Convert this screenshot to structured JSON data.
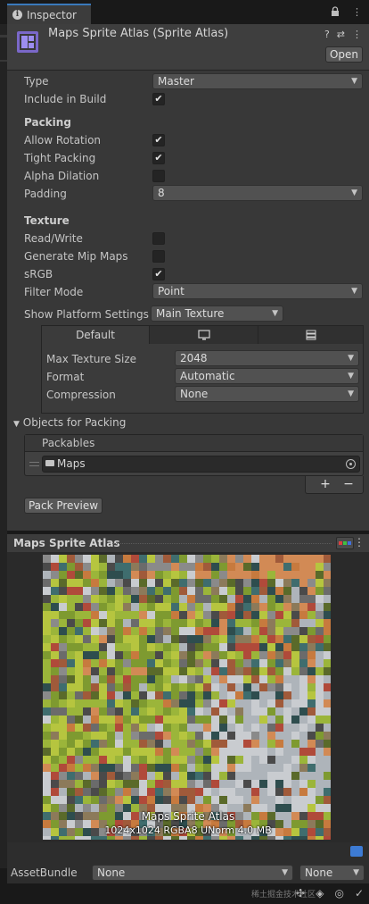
{
  "window": {
    "tab_label": "Inspector",
    "tab_icons": [
      "lock-icon",
      "kebab-icon"
    ]
  },
  "header": {
    "title": "Maps Sprite Atlas (Sprite Atlas)",
    "help_glyph": "?",
    "settings_glyph": "⇄",
    "more_glyph": "⋮",
    "open_label": "Open"
  },
  "fields": {
    "type_label": "Type",
    "type_value": "Master",
    "include_build_label": "Include in Build",
    "include_build_checked": true,
    "packing_header": "Packing",
    "allow_rotation_label": "Allow Rotation",
    "allow_rotation_checked": true,
    "tight_packing_label": "Tight Packing",
    "tight_packing_checked": true,
    "alpha_dilation_label": "Alpha Dilation",
    "alpha_dilation_checked": false,
    "padding_label": "Padding",
    "padding_value": "8",
    "texture_header": "Texture",
    "read_write_label": "Read/Write",
    "read_write_checked": false,
    "mip_maps_label": "Generate Mip Maps",
    "mip_maps_checked": false,
    "srgb_label": "sRGB",
    "srgb_checked": true,
    "filter_mode_label": "Filter Mode",
    "filter_mode_value": "Point",
    "platform_settings_label": "Show Platform Settings F",
    "platform_settings_value": "Main Texture"
  },
  "platform": {
    "tabs": [
      "Default",
      "monitor-icon",
      "server-icon"
    ],
    "max_size_label": "Max Texture Size",
    "max_size_value": "2048",
    "format_label": "Format",
    "format_value": "Automatic",
    "compression_label": "Compression",
    "compression_value": "None"
  },
  "packing_objects": {
    "header": "Objects for Packing",
    "list_header": "Packables",
    "items": [
      "Maps"
    ],
    "add_glyph": "+",
    "remove_glyph": "−",
    "pack_preview_label": "Pack Preview"
  },
  "preview": {
    "title": "Maps Sprite Atlas",
    "atlas_name": "Maps Sprite Atlas",
    "atlas_info": "1024x1024 RGBA8 UNorm  4.0 MB"
  },
  "asset_bundle": {
    "label": "AssetBundle",
    "name_value": "None",
    "variant_value": "None"
  },
  "status": {
    "watermark": "稀土掘金技术社区"
  },
  "colors": {
    "accent": "#3a79bb",
    "panel": "#383838",
    "check": "#e4e4e4",
    "tag": "#3d7bd4"
  }
}
